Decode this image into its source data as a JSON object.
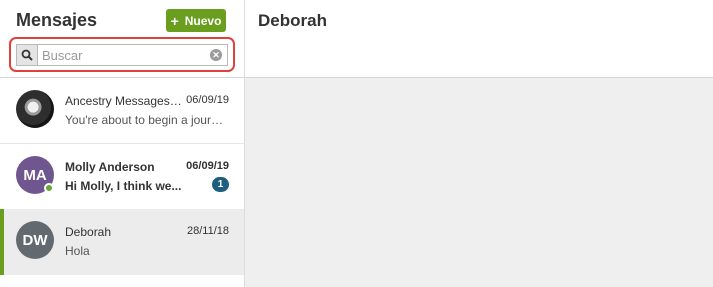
{
  "sidebar": {
    "title": "Mensajes",
    "new_button": {
      "icon": "plus-icon",
      "label": "Nuevo"
    },
    "search": {
      "placeholder": "Buscar",
      "value": "",
      "icon": "search-icon",
      "clear_icon": "clear-icon"
    },
    "conversations": [
      {
        "name": "Ancestry Messages T...",
        "date": "06/09/19",
        "preview": "You're about to begin a journ...",
        "avatar": "photo",
        "unread": false
      },
      {
        "name": "Molly Anderson",
        "date": "06/09/19",
        "preview": "Hi Molly, I think we...",
        "initials": "MA",
        "unread": true,
        "unread_count": "1",
        "online": true
      },
      {
        "name": "Deborah",
        "date": "28/11/18",
        "preview": "Hola",
        "initials": "DW",
        "unread": false,
        "selected": true
      }
    ]
  },
  "main": {
    "contact_name": "Deborah"
  },
  "colors": {
    "accent_green": "#6a9e1f",
    "badge_blue": "#1e5f7e",
    "highlight_red": "#e0413d",
    "avatar_ma": "#6f568f",
    "avatar_dw": "#626a70"
  }
}
